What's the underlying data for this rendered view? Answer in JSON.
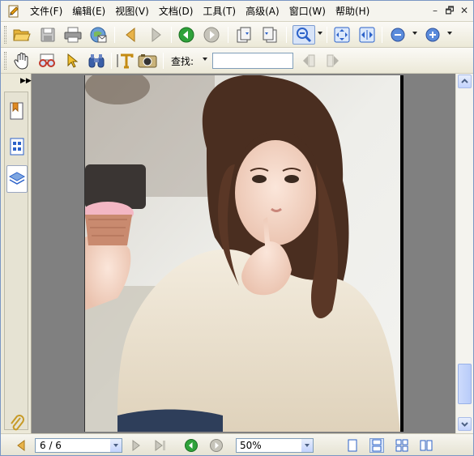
{
  "menu": [
    "文件(F)",
    "编辑(E)",
    "视图(V)",
    "文档(D)",
    "工具(T)",
    "高级(A)",
    "窗口(W)",
    "帮助(H)"
  ],
  "window_controls": {
    "minimize": "–",
    "restore": "🗗",
    "close": "✕"
  },
  "search": {
    "label": "查找:",
    "value": ""
  },
  "navigation": {
    "page": "6 / 6",
    "zoom": "50%"
  },
  "document_image": {
    "subject": "portrait photo of a young woman in a cream knit sweater holding a cupcake"
  },
  "icons": {
    "toolbar1": [
      "folder-open-icon",
      "save-icon",
      "print-icon",
      "email-icon",
      "previous-page-icon",
      "next-page-icon",
      "go-back-icon",
      "go-forward-icon",
      "rotate-icon",
      "rotate-right-icon",
      "zoom-tool-icon",
      "fit-page-icon",
      "fit-width-icon",
      "zoom-out-icon",
      "zoom-in-icon"
    ],
    "toolbar2": [
      "hand-tool-icon",
      "glasses-icon",
      "typewriter-icon",
      "select-arrow-icon",
      "binoculars-icon",
      "text-select-icon",
      "snapshot-icon",
      "find-previous-icon",
      "find-next-icon"
    ],
    "sidepanel": [
      "bookmarks-icon",
      "page-thumbnails-icon",
      "layers-icon",
      "attachments-icon"
    ]
  },
  "colors": {
    "accent": "#2c62c9",
    "toolbar_bg": "#ece9d8",
    "workspace": "#808080"
  }
}
